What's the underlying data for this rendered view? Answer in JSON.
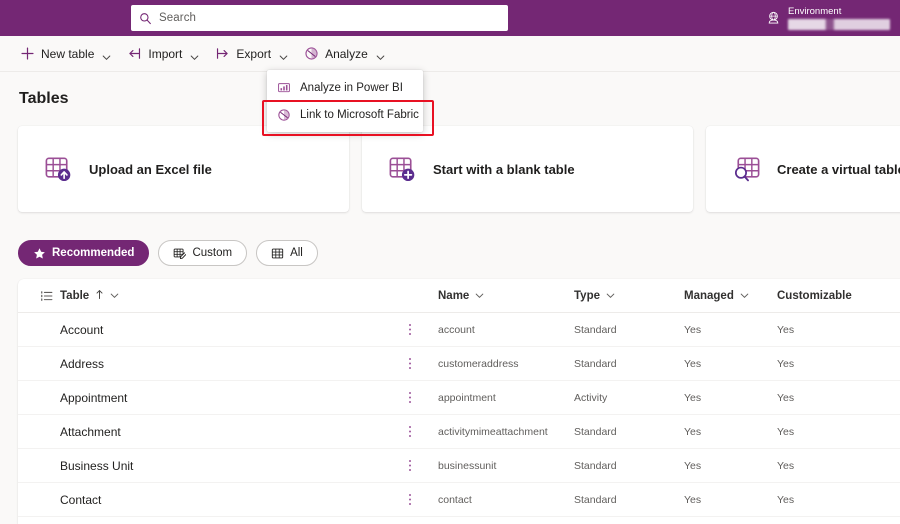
{
  "header": {
    "search": {
      "placeholder": "Search",
      "icon": "search-icon"
    },
    "environment": {
      "label": "Environment",
      "value": "",
      "icon": "environment-globe-icon"
    },
    "bar_color": "#742774"
  },
  "commandbar": {
    "items": [
      {
        "label": "New table",
        "icon": "plus-icon",
        "has_chevron": true
      },
      {
        "label": "Import",
        "icon": "import-arrow-icon",
        "has_chevron": true
      },
      {
        "label": "Export",
        "icon": "export-arrow-icon",
        "has_chevron": true
      },
      {
        "label": "Analyze",
        "icon": "analyze-fabric-icon",
        "has_chevron": true
      }
    ]
  },
  "analyze_menu": {
    "items": [
      {
        "label": "Analyze in Power BI",
        "icon": "power-bi-icon"
      },
      {
        "label": "Link to Microsoft Fabric",
        "icon": "microsoft-fabric-icon"
      }
    ],
    "highlight": {
      "item_index": 1,
      "color": "#e81123"
    }
  },
  "page": {
    "title": "Tables"
  },
  "cards": [
    {
      "label": "Upload an Excel file",
      "icon": "table-upload-icon"
    },
    {
      "label": "Start with a blank table",
      "icon": "table-add-icon"
    },
    {
      "label": "Create a virtual table",
      "icon": "table-search-icon"
    }
  ],
  "filters": {
    "items": [
      {
        "label": "Recommended",
        "icon": "star-icon",
        "selected": true
      },
      {
        "label": "Custom",
        "icon": "table-edit-icon",
        "selected": false
      },
      {
        "label": "All",
        "icon": "table-grid-icon",
        "selected": false
      }
    ],
    "selected_color": "#742774"
  },
  "table": {
    "columns": [
      {
        "label": "Table",
        "sort": "ascending",
        "has_chevron": true
      },
      {
        "label": "Name",
        "has_chevron": true
      },
      {
        "label": "Type",
        "has_chevron": true
      },
      {
        "label": "Managed",
        "has_chevron": true
      },
      {
        "label": "Customizable",
        "has_chevron": false
      }
    ],
    "row_icon": "list-view-icon",
    "rows": [
      {
        "display": "Account",
        "name": "account",
        "type": "Standard",
        "managed": "Yes",
        "customizable": "Yes"
      },
      {
        "display": "Address",
        "name": "customeraddress",
        "type": "Standard",
        "managed": "Yes",
        "customizable": "Yes"
      },
      {
        "display": "Appointment",
        "name": "appointment",
        "type": "Activity",
        "managed": "Yes",
        "customizable": "Yes"
      },
      {
        "display": "Attachment",
        "name": "activitymimeattachment",
        "type": "Standard",
        "managed": "Yes",
        "customizable": "Yes"
      },
      {
        "display": "Business Unit",
        "name": "businessunit",
        "type": "Standard",
        "managed": "Yes",
        "customizable": "Yes"
      },
      {
        "display": "Contact",
        "name": "contact",
        "type": "Standard",
        "managed": "Yes",
        "customizable": "Yes"
      }
    ]
  }
}
